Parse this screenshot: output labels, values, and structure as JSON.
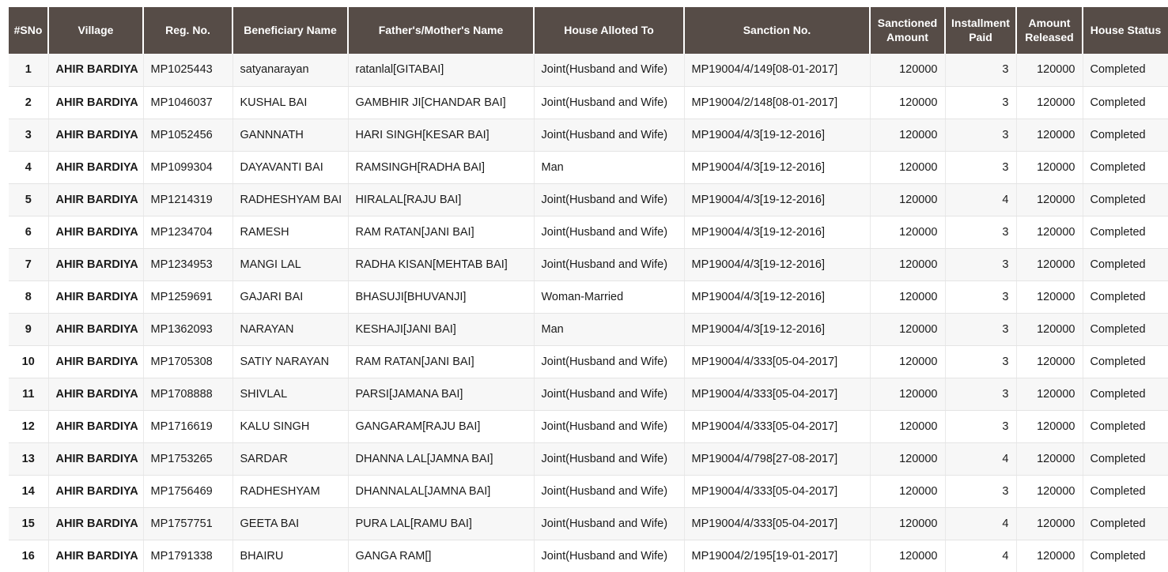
{
  "table": {
    "columns": [
      {
        "key": "sno",
        "label": "#SNo"
      },
      {
        "key": "village",
        "label": "Village"
      },
      {
        "key": "regno",
        "label": "Reg. No."
      },
      {
        "key": "benef",
        "label": "Beneficiary Name"
      },
      {
        "key": "parent",
        "label": "Father's/Mother's Name"
      },
      {
        "key": "allot",
        "label": "House Alloted To"
      },
      {
        "key": "sanction",
        "label": "Sanction No."
      },
      {
        "key": "amount",
        "label": "Sanctioned Amount"
      },
      {
        "key": "install",
        "label": "Installment Paid"
      },
      {
        "key": "released",
        "label": "Amount Released"
      },
      {
        "key": "status",
        "label": "House Status"
      }
    ],
    "header_bg": "#564c47",
    "header_fg": "#ffffff",
    "stripe_bg": "#f7f7f7",
    "rows": [
      {
        "sno": "1",
        "village": "AHIR BARDIYA",
        "regno": "MP1025443",
        "benef": "satyanarayan",
        "parent": "ratanlal[GITABAI]",
        "allot": "Joint(Husband and Wife)",
        "sanction": "MP19004/4/149[08-01-2017]",
        "amount": "120000",
        "install": "3",
        "released": "120000",
        "status": "Completed"
      },
      {
        "sno": "2",
        "village": "AHIR BARDIYA",
        "regno": "MP1046037",
        "benef": "KUSHAL BAI",
        "parent": "GAMBHIR JI[CHANDAR BAI]",
        "allot": "Joint(Husband and Wife)",
        "sanction": "MP19004/2/148[08-01-2017]",
        "amount": "120000",
        "install": "3",
        "released": "120000",
        "status": "Completed"
      },
      {
        "sno": "3",
        "village": "AHIR BARDIYA",
        "regno": "MP1052456",
        "benef": "GANNNATH",
        "parent": "HARI SINGH[KESAR BAI]",
        "allot": "Joint(Husband and Wife)",
        "sanction": "MP19004/4/3[19-12-2016]",
        "amount": "120000",
        "install": "3",
        "released": "120000",
        "status": "Completed"
      },
      {
        "sno": "4",
        "village": "AHIR BARDIYA",
        "regno": "MP1099304",
        "benef": "DAYAVANTI BAI",
        "parent": "RAMSINGH[RADHA BAI]",
        "allot": "Man",
        "sanction": "MP19004/4/3[19-12-2016]",
        "amount": "120000",
        "install": "3",
        "released": "120000",
        "status": "Completed"
      },
      {
        "sno": "5",
        "village": "AHIR BARDIYA",
        "regno": "MP1214319",
        "benef": "RADHESHYAM BAI",
        "parent": "HIRALAL[RAJU BAI]",
        "allot": "Joint(Husband and Wife)",
        "sanction": "MP19004/4/3[19-12-2016]",
        "amount": "120000",
        "install": "4",
        "released": "120000",
        "status": "Completed"
      },
      {
        "sno": "6",
        "village": "AHIR BARDIYA",
        "regno": "MP1234704",
        "benef": "RAMESH",
        "parent": "RAM RATAN[JANI BAI]",
        "allot": "Joint(Husband and Wife)",
        "sanction": "MP19004/4/3[19-12-2016]",
        "amount": "120000",
        "install": "3",
        "released": "120000",
        "status": "Completed"
      },
      {
        "sno": "7",
        "village": "AHIR BARDIYA",
        "regno": "MP1234953",
        "benef": "MANGI LAL",
        "parent": "RADHA KISAN[MEHTAB BAI]",
        "allot": "Joint(Husband and Wife)",
        "sanction": "MP19004/4/3[19-12-2016]",
        "amount": "120000",
        "install": "3",
        "released": "120000",
        "status": "Completed"
      },
      {
        "sno": "8",
        "village": "AHIR BARDIYA",
        "regno": "MP1259691",
        "benef": "GAJARI BAI",
        "parent": "BHASUJI[BHUVANJI]",
        "allot": "Woman-Married",
        "sanction": "MP19004/4/3[19-12-2016]",
        "amount": "120000",
        "install": "3",
        "released": "120000",
        "status": "Completed"
      },
      {
        "sno": "9",
        "village": "AHIR BARDIYA",
        "regno": "MP1362093",
        "benef": "NARAYAN",
        "parent": "KESHAJI[JANI BAI]",
        "allot": "Man",
        "sanction": "MP19004/4/3[19-12-2016]",
        "amount": "120000",
        "install": "3",
        "released": "120000",
        "status": "Completed"
      },
      {
        "sno": "10",
        "village": "AHIR BARDIYA",
        "regno": "MP1705308",
        "benef": "SATIY NARAYAN",
        "parent": "RAM RATAN[JANI BAI]",
        "allot": "Joint(Husband and Wife)",
        "sanction": "MP19004/4/333[05-04-2017]",
        "amount": "120000",
        "install": "3",
        "released": "120000",
        "status": "Completed"
      },
      {
        "sno": "11",
        "village": "AHIR BARDIYA",
        "regno": "MP1708888",
        "benef": "SHIVLAL",
        "parent": "PARSI[JAMANA BAI]",
        "allot": "Joint(Husband and Wife)",
        "sanction": "MP19004/4/333[05-04-2017]",
        "amount": "120000",
        "install": "3",
        "released": "120000",
        "status": "Completed"
      },
      {
        "sno": "12",
        "village": "AHIR BARDIYA",
        "regno": "MP1716619",
        "benef": "KALU SINGH",
        "parent": "GANGARAM[RAJU BAI]",
        "allot": "Joint(Husband and Wife)",
        "sanction": "MP19004/4/333[05-04-2017]",
        "amount": "120000",
        "install": "3",
        "released": "120000",
        "status": "Completed"
      },
      {
        "sno": "13",
        "village": "AHIR BARDIYA",
        "regno": "MP1753265",
        "benef": "SARDAR",
        "parent": "DHANNA LAL[JAMNA BAI]",
        "allot": "Joint(Husband and Wife)",
        "sanction": "MP19004/4/798[27-08-2017]",
        "amount": "120000",
        "install": "4",
        "released": "120000",
        "status": "Completed"
      },
      {
        "sno": "14",
        "village": "AHIR BARDIYA",
        "regno": "MP1756469",
        "benef": "RADHESHYAM",
        "parent": "DHANNALAL[JAMNA BAI]",
        "allot": "Joint(Husband and Wife)",
        "sanction": "MP19004/4/333[05-04-2017]",
        "amount": "120000",
        "install": "3",
        "released": "120000",
        "status": "Completed"
      },
      {
        "sno": "15",
        "village": "AHIR BARDIYA",
        "regno": "MP1757751",
        "benef": "GEETA BAI",
        "parent": "PURA LAL[RAMU BAI]",
        "allot": "Joint(Husband and Wife)",
        "sanction": "MP19004/4/333[05-04-2017]",
        "amount": "120000",
        "install": "4",
        "released": "120000",
        "status": "Completed"
      },
      {
        "sno": "16",
        "village": "AHIR BARDIYA",
        "regno": "MP1791338",
        "benef": "BHAIRU",
        "parent": "GANGA RAM[]",
        "allot": "Joint(Husband and Wife)",
        "sanction": "MP19004/2/195[19-01-2017]",
        "amount": "120000",
        "install": "4",
        "released": "120000",
        "status": "Completed"
      }
    ]
  }
}
